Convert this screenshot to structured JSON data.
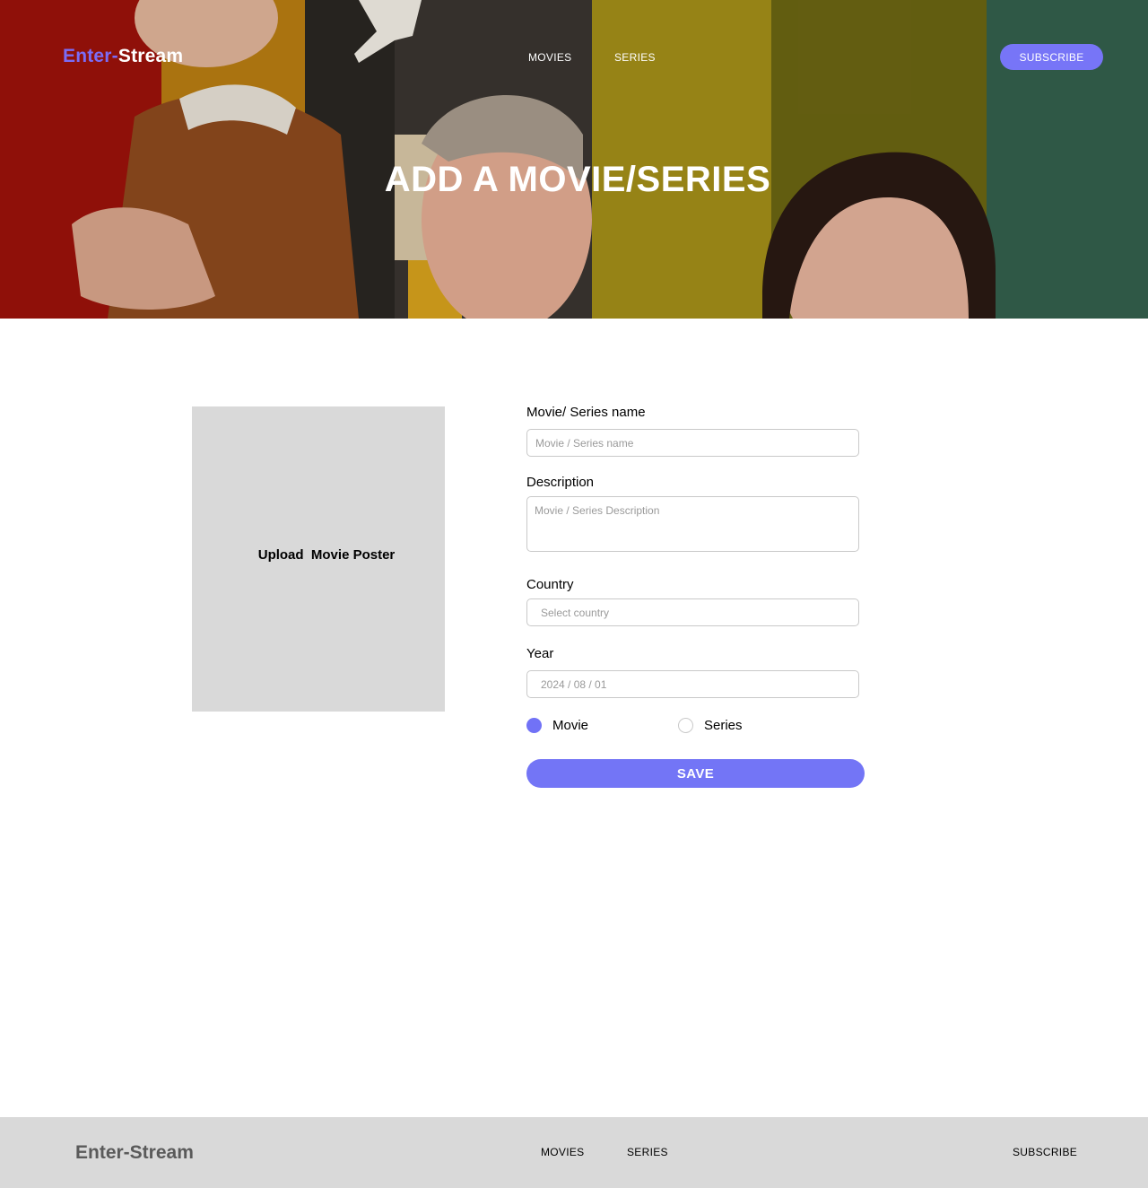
{
  "header": {
    "logo_part1": "Enter-",
    "logo_part2": "Stream",
    "nav": {
      "movies": "MOVIES",
      "series": "SERIES"
    },
    "subscribe": "SUBSCRIBE"
  },
  "hero": {
    "title": "ADD A MOVIE/SERIES"
  },
  "poster_upload": {
    "label": "Upload  Movie Poster"
  },
  "form": {
    "name": {
      "label": "Movie/ Series name",
      "placeholder": "Movie / Series name"
    },
    "description": {
      "label": "Description",
      "placeholder": "Movie / Series Description"
    },
    "country": {
      "label": "Country",
      "placeholder": "Select country"
    },
    "year": {
      "label": "Year",
      "placeholder": "2024 / 08 / 01"
    },
    "type_options": [
      {
        "label": "Movie",
        "selected": true
      },
      {
        "label": "Series",
        "selected": false
      }
    ],
    "save": "SAVE"
  },
  "footer": {
    "logo": "Enter-Stream",
    "nav": {
      "movies": "MOVIES",
      "series": "SERIES",
      "subscribe": "SUBSCRIBE"
    }
  },
  "colors": {
    "accent": "#7375f6",
    "footer_bg": "#d9d9d9",
    "poster_bg": "#d9d9d9"
  }
}
